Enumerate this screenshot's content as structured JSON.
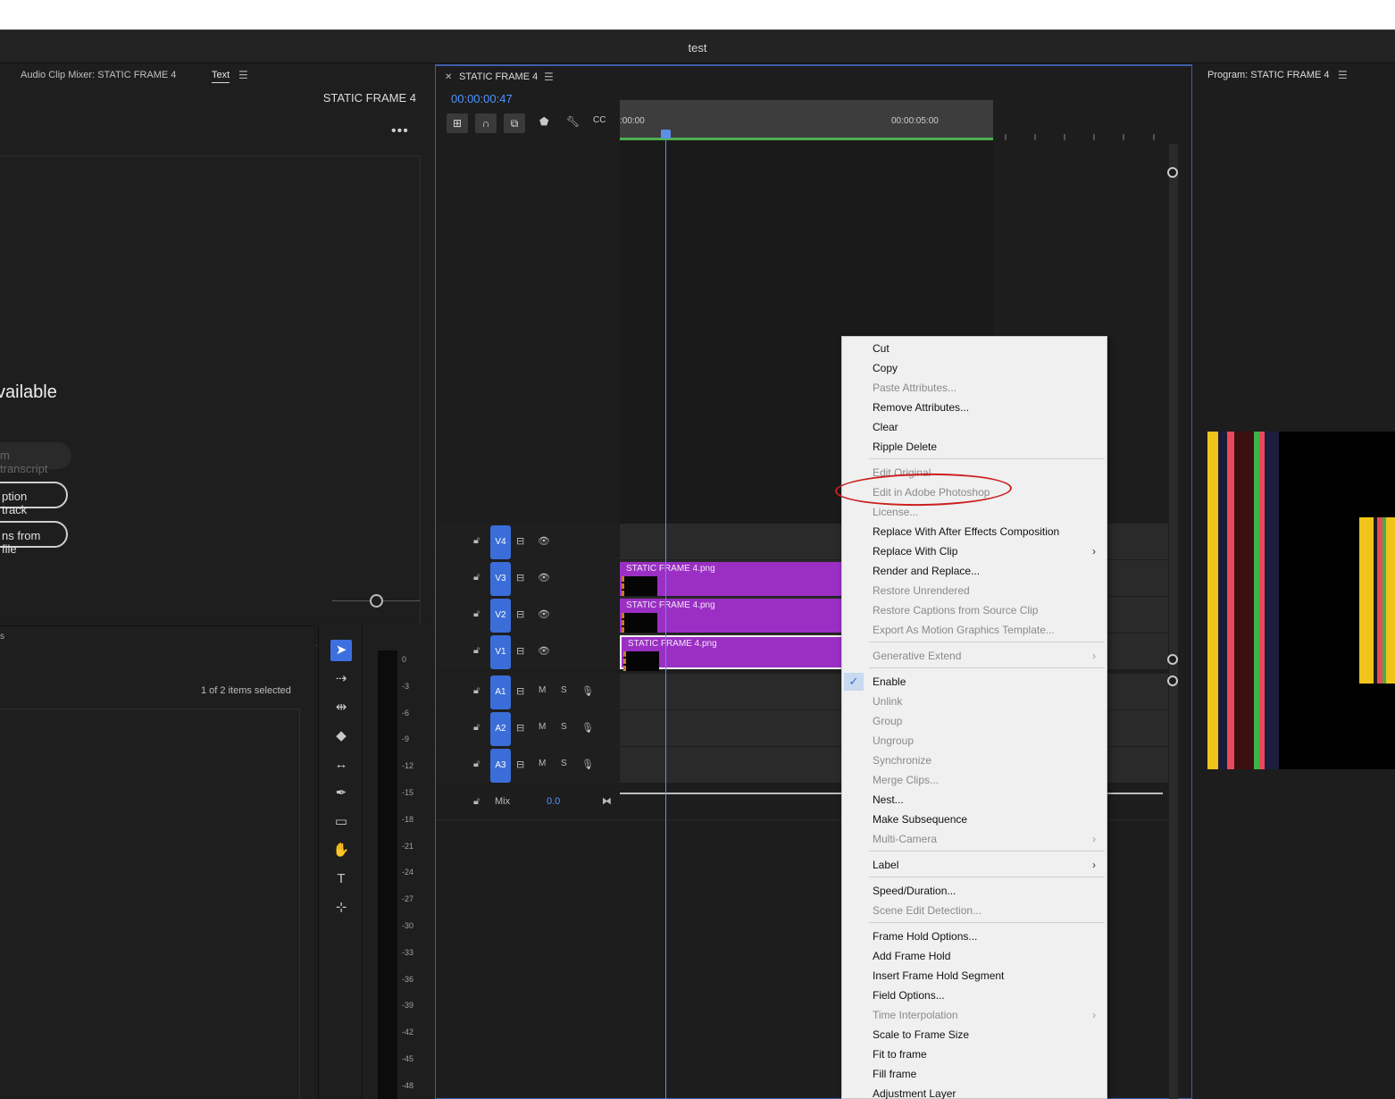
{
  "window": {
    "title": "test"
  },
  "left_panel": {
    "tab_audio_mixer": "Audio Clip Mixer: STATIC FRAME 4",
    "tab_text": "Text",
    "sequence_name": "STATIC FRAME 4",
    "more_label": "•••",
    "heading_partial": "vailable",
    "pill_transcript": "m transcript",
    "pill_caption_track": "ption track",
    "pill_from_file": "ns from file"
  },
  "project_panel": {
    "items_selected": "1 of 2 items selected",
    "tab_partial": "s"
  },
  "audio_meter": {
    "db_labels": [
      "0",
      "-3",
      "-6",
      "-9",
      "-12",
      "-15",
      "-18",
      "-21",
      "-24",
      "-27",
      "-30",
      "-33",
      "-36",
      "-39",
      "-42",
      "-45",
      "-48"
    ]
  },
  "timeline": {
    "tab_title": "STATIC FRAME 4",
    "timecode": "00:00:00:47",
    "ruler_start": ":00:00",
    "ruler_5s": "00:00:05:00",
    "video_tracks": [
      {
        "label": "V4",
        "has_clip": false
      },
      {
        "label": "V3",
        "has_clip": true,
        "clip_name": "STATIC FRAME 4.png"
      },
      {
        "label": "V2",
        "has_clip": true,
        "clip_name": "STATIC FRAME 4.png"
      },
      {
        "label": "V1",
        "has_clip": true,
        "clip_name": "STATIC FRAME 4.png",
        "selected": true
      }
    ],
    "audio_tracks": [
      {
        "label": "A1",
        "mute": "M",
        "solo": "S"
      },
      {
        "label": "A2",
        "mute": "M",
        "solo": "S"
      },
      {
        "label": "A3",
        "mute": "M",
        "solo": "S"
      }
    ],
    "mix_label": "Mix",
    "mix_value": "0.0",
    "accent_color": "#3a6dd8",
    "clip_color": "#9b2fc4"
  },
  "program": {
    "title": "Program: STATIC FRAME 4"
  },
  "context_menu": {
    "items": [
      {
        "label": "Cut",
        "enabled": true
      },
      {
        "label": "Copy",
        "enabled": true
      },
      {
        "label": "Paste Attributes...",
        "enabled": false
      },
      {
        "label": "Remove Attributes...",
        "enabled": true
      },
      {
        "label": "Clear",
        "enabled": true
      },
      {
        "label": "Ripple Delete",
        "enabled": true
      },
      {
        "label": "Edit Original",
        "enabled": false
      },
      {
        "label": "Edit in Adobe Photoshop",
        "enabled": false,
        "highlighted": true
      },
      {
        "label": "License...",
        "enabled": false
      },
      {
        "label": "Replace With After Effects Composition",
        "enabled": true
      },
      {
        "label": "Replace With Clip",
        "enabled": true,
        "submenu": true
      },
      {
        "label": "Render and Replace...",
        "enabled": true
      },
      {
        "label": "Restore Unrendered",
        "enabled": false
      },
      {
        "label": "Restore Captions from Source Clip",
        "enabled": false
      },
      {
        "label": "Export As Motion Graphics Template...",
        "enabled": false
      },
      {
        "label": "Generative Extend",
        "enabled": false,
        "submenu": true
      },
      {
        "label": "Enable",
        "enabled": true,
        "checked": true
      },
      {
        "label": "Unlink",
        "enabled": false
      },
      {
        "label": "Group",
        "enabled": false
      },
      {
        "label": "Ungroup",
        "enabled": false
      },
      {
        "label": "Synchronize",
        "enabled": false
      },
      {
        "label": "Merge Clips...",
        "enabled": false
      },
      {
        "label": "Nest...",
        "enabled": true
      },
      {
        "label": "Make Subsequence",
        "enabled": true
      },
      {
        "label": "Multi-Camera",
        "enabled": false,
        "submenu": true
      },
      {
        "label": "Label",
        "enabled": true,
        "submenu": true
      },
      {
        "label": "Speed/Duration...",
        "enabled": true
      },
      {
        "label": "Scene Edit Detection...",
        "enabled": false
      },
      {
        "label": "Frame Hold Options...",
        "enabled": true
      },
      {
        "label": "Add Frame Hold",
        "enabled": true
      },
      {
        "label": "Insert Frame Hold Segment",
        "enabled": true
      },
      {
        "label": "Field Options...",
        "enabled": true
      },
      {
        "label": "Time Interpolation",
        "enabled": false,
        "submenu": true
      },
      {
        "label": "Scale to Frame Size",
        "enabled": true
      },
      {
        "label": "Fit to frame",
        "enabled": true
      },
      {
        "label": "Fill frame",
        "enabled": true
      },
      {
        "label": "Adjustment Layer",
        "enabled": true
      }
    ]
  }
}
